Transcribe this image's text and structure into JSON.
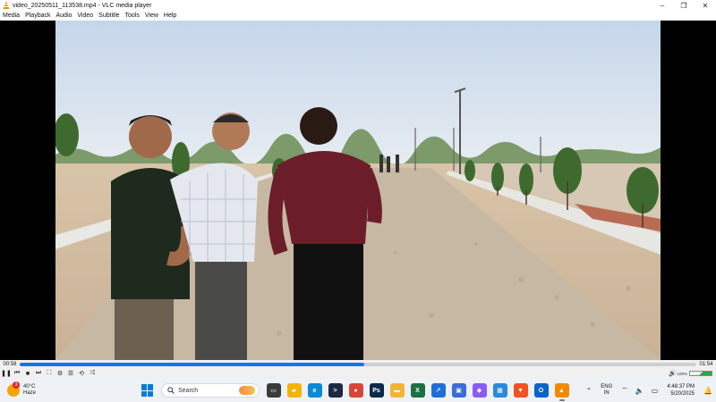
{
  "window": {
    "title": "video_20250511_113538.mp4 - VLC media player",
    "minimize_glyph": "–",
    "maximize_glyph": "❐",
    "close_glyph": "✕"
  },
  "menu": {
    "items": [
      "Media",
      "Playback",
      "Audio",
      "Video",
      "Subtitle",
      "Tools",
      "View",
      "Help"
    ]
  },
  "player": {
    "elapsed": "00:58",
    "duration": "01:54",
    "progress": 0.509,
    "volume_percent": "100%",
    "controls": {
      "play_pause": "❚❚",
      "prev": "⏮",
      "stop": "■",
      "next": "⏭",
      "fullscreen": "⛶",
      "extended": "⚙",
      "playlist": "☰",
      "loop": "⟲",
      "random": "⤮"
    }
  },
  "taskbar": {
    "weather": {
      "temp": "40°C",
      "condition": "Haze",
      "badge": "3"
    },
    "search_placeholder": "Search",
    "apps": [
      {
        "name": "task-view-icon",
        "color": "#3b3b3b",
        "glyph": "▭"
      },
      {
        "name": "file-explorer-icon",
        "color": "#f3b400",
        "glyph": "▰"
      },
      {
        "name": "edge-icon",
        "color": "#0c8ad6",
        "glyph": "e"
      },
      {
        "name": "terminal-icon",
        "color": "#1e2a44",
        "glyph": ">"
      },
      {
        "name": "chrome-icon",
        "color": "#db4437",
        "glyph": "●"
      },
      {
        "name": "photoshop-icon",
        "color": "#0a2a4a",
        "glyph": "Ps"
      },
      {
        "name": "folder-icon",
        "color": "#f1b534",
        "glyph": "▬"
      },
      {
        "name": "excel-icon",
        "color": "#1d7044",
        "glyph": "X"
      },
      {
        "name": "app-blue-icon",
        "color": "#1e6fd9",
        "glyph": "↗"
      },
      {
        "name": "photos-icon",
        "color": "#3c6cd6",
        "glyph": "▣"
      },
      {
        "name": "copilot-icon",
        "color": "#8a5cf6",
        "glyph": "◆"
      },
      {
        "name": "calendar-icon",
        "color": "#2a8bdc",
        "glyph": "▦"
      },
      {
        "name": "brave-icon",
        "color": "#f25322",
        "glyph": "▼"
      },
      {
        "name": "outlook-icon",
        "color": "#0a64c8",
        "glyph": "O"
      },
      {
        "name": "vlc-icon",
        "color": "#f28a00",
        "glyph": "▲"
      }
    ],
    "tray": {
      "chevron": "⌃",
      "lang_top": "ENG",
      "lang_bottom": "IN",
      "wifi": "⌔",
      "speaker": "🔈",
      "battery": "▭",
      "time": "4:48:37 PM",
      "date": "5/20/2025",
      "notification": "🔔"
    }
  }
}
